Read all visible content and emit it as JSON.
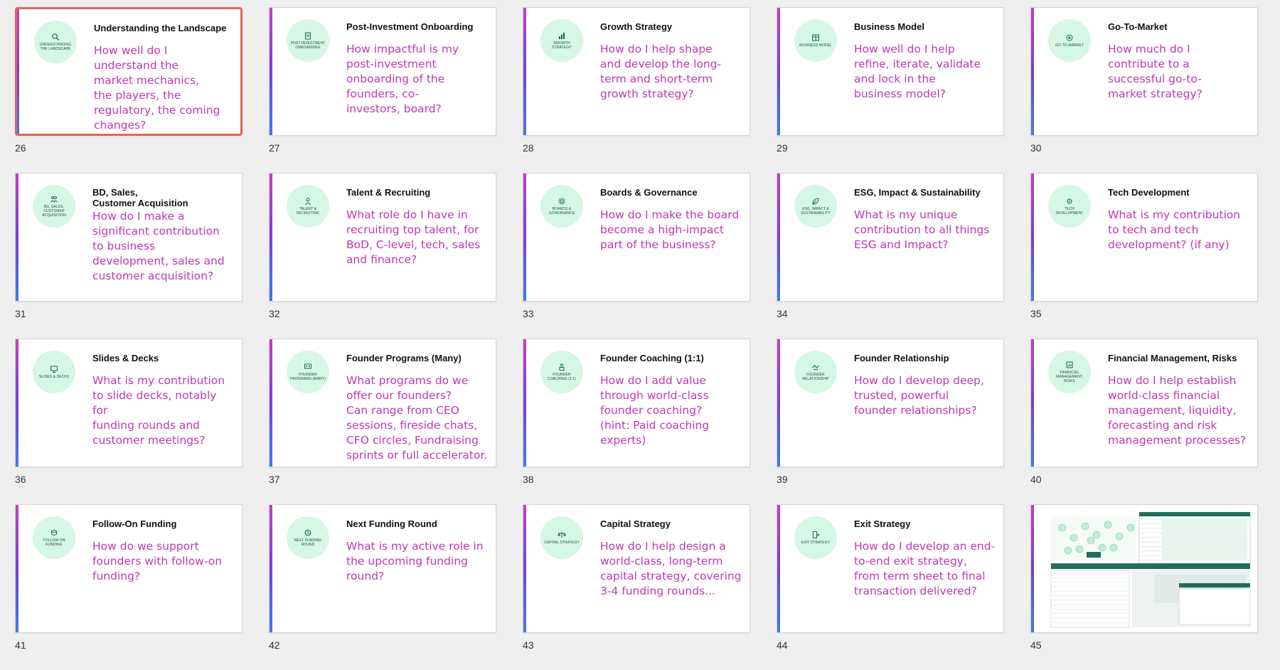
{
  "accent_colors": {
    "top": "#c13fc0",
    "mid": "#7a3fd6",
    "bottom": "#3b7ee0",
    "badge_bg": "#d7f7e6",
    "question_text": "#c038b4",
    "selection_border": "#e0655c"
  },
  "slides": [
    {
      "number": "26",
      "title": "Understanding the Landscape",
      "badge_label": "UNDERSTANDING THE LANDSCAPE",
      "icon": "magnifier-icon",
      "question": "How well do I\nunderstand the\nmarket mechanics,\nthe players, the\nregulatory, the coming\nchanges?",
      "selected": true
    },
    {
      "number": "27",
      "title": "Post-Investment Onboarding",
      "badge_label": "POST-INVESTMENT ONBOARDING",
      "icon": "clipboard-icon",
      "question": "How impactful is my\npost-investment\nonboarding of the\nfounders, co-\ninvestors, board?"
    },
    {
      "number": "28",
      "title": "Growth Strategy",
      "badge_label": "GROWTH STRATEGY",
      "icon": "bar-chart-icon",
      "question": "How do I help shape\nand develop the long-\nterm and short-term\ngrowth strategy?"
    },
    {
      "number": "29",
      "title": "Business Model",
      "badge_label": "BUSINESS MODEL",
      "icon": "grid-icon",
      "question": "How well do I help\nrefine, iterate, validate\nand lock in the\nbusiness model?"
    },
    {
      "number": "30",
      "title": "Go-To-Market",
      "badge_label": "GO-TO-MARKET",
      "icon": "target-icon",
      "question": "How much do I\ncontribute to a\nsuccessful go-to-\nmarket strategy?"
    },
    {
      "number": "31",
      "title": "BD, Sales,\nCustomer Acquisition",
      "badge_label": "BD, SALES, CUSTOMER ACQUISITION",
      "icon": "people-icon",
      "question": "How do I make a\nsignificant contribution\nto business\ndevelopment, sales and\ncustomer acquisition?"
    },
    {
      "number": "32",
      "title": "Talent & Recruiting",
      "badge_label": "TALENT & RECRUITING",
      "icon": "person-icon",
      "question": "What role do I have in\nrecruiting top talent, for\nBoD, C-level, tech, sales\nand finance?"
    },
    {
      "number": "33",
      "title": "Boards & Governance",
      "badge_label": "BOARDS & GOVERNANCE",
      "icon": "gear-icon",
      "question": "How do I make the board\nbecome a high-impact\npart of the business?"
    },
    {
      "number": "34",
      "title": "ESG, Impact & Sustainability",
      "badge_label": "ESG, IMPACT & SUSTAINABILITY",
      "icon": "leaf-icon",
      "question": "What is my unique\ncontribution to all things\nESG and Impact?"
    },
    {
      "number": "35",
      "title": "Tech Development",
      "badge_label": "TECH DEVELOPMENT",
      "icon": "cog-chip-icon",
      "question": "What is my contribution\nto tech and tech\ndevelopment? (if any)"
    },
    {
      "number": "36",
      "title": "Slides & Decks",
      "badge_label": "SLIDES & DECKS",
      "icon": "presentation-icon",
      "question": "What is my contribution\nto slide decks, notably for\nfunding rounds and\ncustomer meetings?"
    },
    {
      "number": "37",
      "title": "Founder Programs (Many)",
      "badge_label": "FOUNDER PROGRAMS (MANY)",
      "icon": "group-icon",
      "question": "What programs do we\noffer our founders?\nCan range from CEO\nsessions, fireside chats,\nCFO circles, Fundraising\nsprints or full accelerator."
    },
    {
      "number": "38",
      "title": "Founder Coaching (1:1)",
      "badge_label": "FOUNDER COACHING (1:1)",
      "icon": "coach-icon",
      "question": "How do I add value\nthrough world-class\nfounder coaching?\n(hint: Paid coaching\nexperts)"
    },
    {
      "number": "39",
      "title": "Founder Relationship",
      "badge_label": "FOUNDER RELATIONSHIP",
      "icon": "handshake-icon",
      "question": "How do I develop deep,\ntrusted, powerful\nfounder relationships?"
    },
    {
      "number": "40",
      "title": "Financial Management, Risks",
      "badge_label": "FINANCIAL MANAGEMENT, RISKS",
      "icon": "finance-icon",
      "question": "How do I help establish\nworld-class financial\nmanagement, liquidity,\nforecasting and risk\nmanagement processes?"
    },
    {
      "number": "41",
      "title": "Follow-On Funding",
      "badge_label": "FOLLOW-ON FUNDING",
      "icon": "coins-icon",
      "question": "How do we support\nfounders with follow-on\nfunding?"
    },
    {
      "number": "42",
      "title": "Next Funding Round",
      "badge_label": "NEXT FUNDING ROUND",
      "icon": "cycle-icon",
      "question": "What is my active role in\nthe upcoming funding\nround?"
    },
    {
      "number": "43",
      "title": "Capital Strategy",
      "badge_label": "CAPITAL STRATEGY",
      "icon": "scale-icon",
      "question": "How do I help design a\nworld-class, long-term\ncapital strategy, covering\n3-4 funding rounds..."
    },
    {
      "number": "44",
      "title": "Exit Strategy",
      "badge_label": "EXIT STRATEGY",
      "icon": "door-exit-icon",
      "question": "How do I develop an end-\nto-end exit strategy,\nfrom term sheet to final\ntransaction delivered?"
    },
    {
      "number": "45",
      "title": "",
      "badge_label": "",
      "icon": "",
      "question": "",
      "is_preview": true
    }
  ]
}
